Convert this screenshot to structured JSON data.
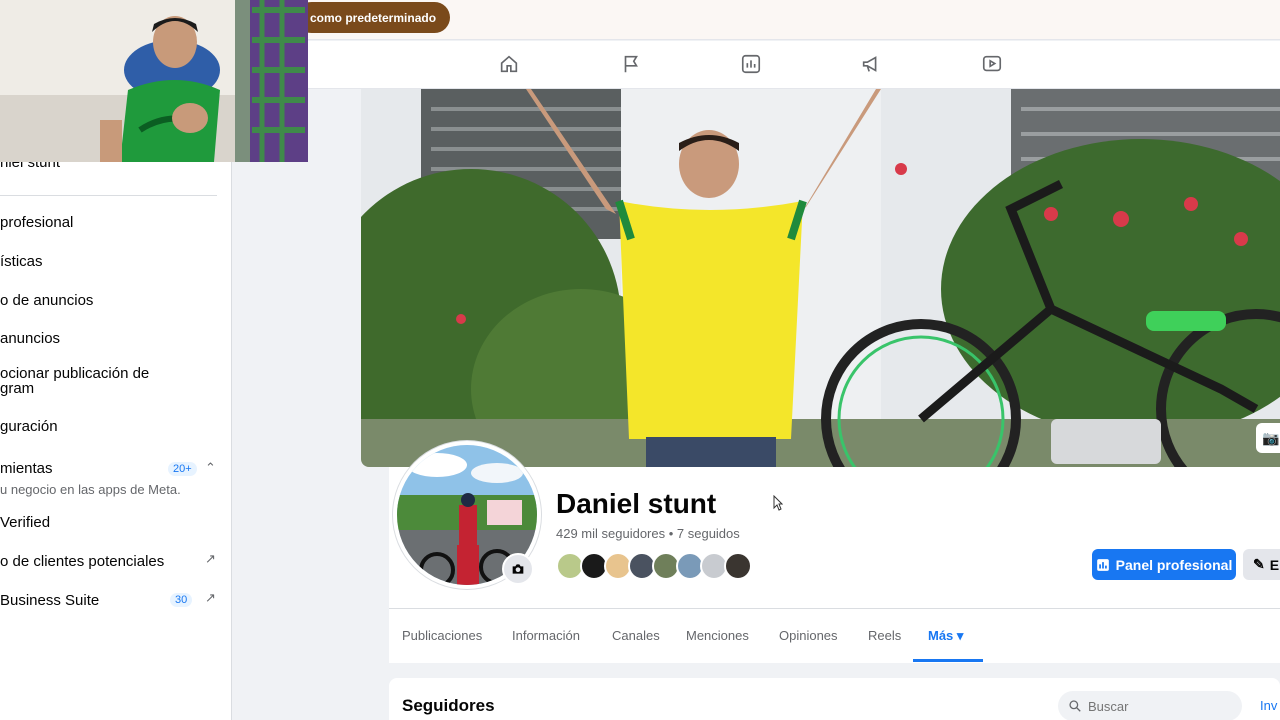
{
  "banner": {
    "button_label": "como predeterminado"
  },
  "nav_icons": [
    "home-icon",
    "flag-icon",
    "insights-icon",
    "megaphone-icon",
    "video-icon"
  ],
  "sidebar": {
    "cut_title": "niel stunt",
    "items": [
      {
        "label": "profesional"
      },
      {
        "label": "ísticas"
      },
      {
        "label": "o de anuncios"
      },
      {
        "label": "anuncios"
      },
      {
        "label_line1": "ocionar publicación de",
        "label_line2": "gram"
      },
      {
        "label": "guración"
      },
      {
        "label": "mientas",
        "badge": "20+",
        "sub": "u negocio en las apps de Meta."
      },
      {
        "label": "Verified"
      },
      {
        "label": "o de clientes potenciales"
      },
      {
        "label": "Business Suite",
        "badge": "30"
      }
    ]
  },
  "profile": {
    "name": "Daniel stunt",
    "stats": "429 mil seguidores • 7 seguidos",
    "panel_button": "Panel profesional",
    "edit_button": "E"
  },
  "tabs": [
    {
      "label": "Publicaciones"
    },
    {
      "label": "Información"
    },
    {
      "label": "Canales"
    },
    {
      "label": "Menciones"
    },
    {
      "label": "Opiniones"
    },
    {
      "label": "Reels"
    },
    {
      "label": "Más ▾"
    }
  ],
  "followers_card": {
    "title": "Seguidores",
    "search_placeholder": "Buscar",
    "invite_label": "Inv"
  },
  "colors": {
    "accent": "#1877f2",
    "banner": "#7a4a1b"
  }
}
